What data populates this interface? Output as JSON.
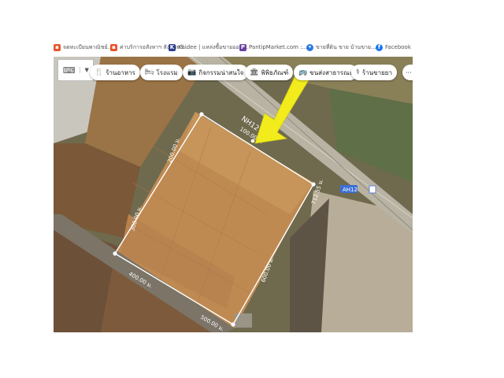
{
  "bookmarks": [
    {
      "label": "จดทะเบียนพาณิชย์...",
      "icon": "bookmark-favicon-orange",
      "color": "#e8542a"
    },
    {
      "label": "ค่าบริการอสังหาฯ สังคมทรั...",
      "icon": "bookmark-favicon-orange",
      "color": "#e8542a"
    },
    {
      "label": "Kaidee | แหล่งซื้อขายออน...",
      "icon": "kaidee-icon",
      "color": "#2c3e8c"
    },
    {
      "label": "PantipMarket.com :...",
      "icon": "pantip-icon",
      "color": "#6a3fa0"
    },
    {
      "label": "ขายที่ดิน ขาย บ้านขาย...",
      "icon": "globe-icon",
      "color": "#2a7ae0"
    },
    {
      "label": "Facebook",
      "icon": "facebook-icon",
      "color": "#1877f2"
    }
  ],
  "map": {
    "menu_button": {
      "icon": "keyboard-icon",
      "dropdown_icon": "chevron-down-icon"
    },
    "chips": [
      {
        "label": "ร้านอาหาร",
        "icon": "fork-knife-icon",
        "glyph": "🍴"
      },
      {
        "label": "โรงแรม",
        "icon": "bed-icon",
        "glyph": "🛏"
      },
      {
        "label": "กิจกรรมน่าสนใจ",
        "icon": "camera-icon",
        "glyph": "📷"
      },
      {
        "label": "พิพิธภัณฑ์",
        "icon": "museum-icon",
        "glyph": "🏛"
      },
      {
        "label": "ขนส่งสาธารณะ",
        "icon": "bus-icon",
        "glyph": "🚌"
      },
      {
        "label": "ร้านขายยา",
        "icon": "pharmacy-icon",
        "glyph": "⚕"
      }
    ],
    "more_chip": {
      "label": "···",
      "icon": "more-icon"
    },
    "road_label": "NH12",
    "road_shield": "AH12",
    "measurements": {
      "top_edge": "100.00 ม.",
      "top_left_edge": "200.00 ม.",
      "left_edge": "300.00 ม.",
      "bottom_left_edge": "400.00 ม.",
      "bottom_edge": "500.00 ม.",
      "right_inner_edge": "600.00 ม.",
      "right_edge": "712.55 ม."
    },
    "colors": {
      "arrow": "#f2ec1c",
      "boundary": "#ffffff",
      "road": "#b9b3a4",
      "shield": "#3b6fd6"
    }
  }
}
